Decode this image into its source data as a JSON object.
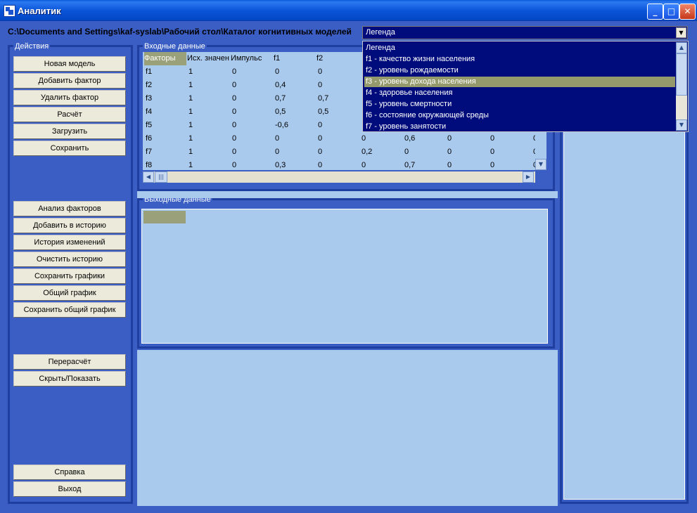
{
  "window": {
    "title": "Аналитик",
    "min": "_",
    "max": "□",
    "close": "✕"
  },
  "path": "C:\\Documents and Settings\\kaf-syslab\\Рабочий стол\\Каталог когнитивных моделей",
  "legend_combo": {
    "value": "Легенда",
    "items": [
      "Легенда",
      "f1 - качество жизни населения",
      "f2 - уровень рождаемости",
      "f3 - уровень дохода населения",
      "f4 - здоровье населения",
      "f5 - уровень смертности",
      "f6 - состояние окружающей среды",
      "f7 - уровень занятости"
    ],
    "selected_index": 3
  },
  "actions": {
    "label": "Действия",
    "group1": [
      "Новая модель",
      "Добавить фактор",
      "Удалить фактор",
      "Расчёт",
      "Загрузить",
      "Сохранить"
    ],
    "group2": [
      "Анализ факторов",
      "Добавить в историю",
      "История изменений",
      "Очистить историю",
      "Сохранить графики",
      "Общий график",
      "Сохранить общий график"
    ],
    "group3": [
      "Перерасчёт",
      "Скрыть/Показать"
    ],
    "group4": [
      "Справка",
      "Выход"
    ]
  },
  "input": {
    "label": "Входные данные",
    "headers": [
      "Факторы",
      "Исх. значен",
      "Импульс",
      "f1",
      "f2",
      "",
      "",
      "",
      "",
      ""
    ],
    "rows": [
      [
        "f1",
        "1",
        "0",
        "0",
        "0",
        "",
        "",
        "",
        "",
        ""
      ],
      [
        "f2",
        "1",
        "0",
        "0,4",
        "0",
        "",
        "",
        "",
        "",
        ""
      ],
      [
        "f3",
        "1",
        "0",
        "0,7",
        "0,7",
        "",
        "",
        "",
        "",
        ""
      ],
      [
        "f4",
        "1",
        "0",
        "0,5",
        "0,5",
        "",
        "",
        "",
        "",
        ""
      ],
      [
        "f5",
        "1",
        "0",
        "-0,6",
        "0",
        "",
        "",
        "",
        "",
        ""
      ],
      [
        "f6",
        "1",
        "0",
        "0",
        "0",
        "0",
        "0,6",
        "0",
        "0",
        "0"
      ],
      [
        "f7",
        "1",
        "0",
        "0",
        "0",
        "0,2",
        "0",
        "0",
        "0",
        "0"
      ],
      [
        "f8",
        "1",
        "0",
        "0,3",
        "0",
        "0",
        "0,7",
        "0",
        "0",
        "0"
      ]
    ],
    "partial_col_fragments": [
      "0",
      "0",
      "0",
      "0",
      "0"
    ]
  },
  "output": {
    "label": "Выходные данные"
  }
}
